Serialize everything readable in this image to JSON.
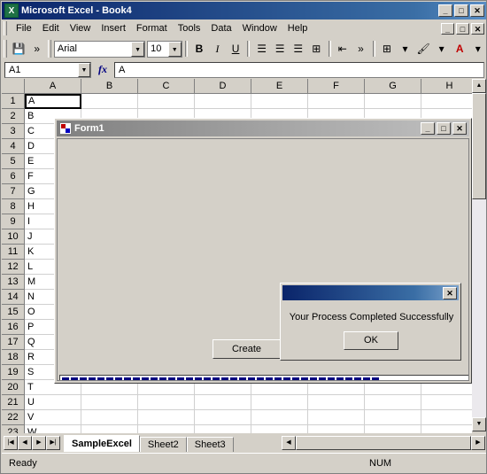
{
  "window": {
    "title": "Microsoft Excel - Book4",
    "icon": "excel-icon",
    "minimize": "_",
    "maximize": "□",
    "close": "✕"
  },
  "menu": {
    "items": [
      "File",
      "Edit",
      "View",
      "Insert",
      "Format",
      "Tools",
      "Data",
      "Window",
      "Help"
    ],
    "doc_minimize": "_",
    "doc_restore": "□",
    "doc_close": "✕"
  },
  "toolbar": {
    "buttons": [
      "save-icon",
      "more-icon"
    ],
    "font_name": "Arial",
    "font_size": "10",
    "bold": "B",
    "italic": "I",
    "underline": "U",
    "align_left": "≡",
    "align_center": "≡",
    "align_right": "≡",
    "merge": "⊞",
    "indent": "⇥",
    "borders": "⊞",
    "fill_color": "A",
    "font_color": "A",
    "dropdown_arrow": "▼"
  },
  "formula_bar": {
    "name_box": "A1",
    "fx": "fx",
    "formula_value": "A"
  },
  "sheet": {
    "columns": [
      "A",
      "B",
      "C",
      "D",
      "E",
      "F",
      "G",
      "H"
    ],
    "rows": [
      1,
      2,
      3,
      4,
      5,
      6,
      7,
      8,
      9,
      10,
      11,
      12,
      13,
      14,
      15,
      16,
      17,
      18,
      19,
      20,
      21,
      22,
      23
    ],
    "column_a_values": [
      "A",
      "B",
      "C",
      "D",
      "E",
      "F",
      "G",
      "H",
      "I",
      "J",
      "K",
      "L",
      "M",
      "N",
      "O",
      "P",
      "Q",
      "R",
      "S",
      "T",
      "U",
      "V",
      "W"
    ],
    "selected_cell": "A1"
  },
  "tabs": {
    "nav_first": "|◀",
    "nav_prev": "◀",
    "nav_next": "▶",
    "nav_last": "▶|",
    "items": [
      {
        "label": "SampleExcel",
        "active": true
      },
      {
        "label": "Sheet2",
        "active": false
      },
      {
        "label": "Sheet3",
        "active": false
      }
    ],
    "scroll_left": "◀",
    "scroll_right": "▶"
  },
  "status_bar": {
    "ready": "Ready",
    "num_lock": "NUM"
  },
  "form": {
    "title": "Form1",
    "minimize": "_",
    "maximize": "□",
    "close": "✕",
    "create_button": "Create",
    "progress_chunks": 36
  },
  "messagebox": {
    "title": "",
    "close": "✕",
    "message": "Your Process Completed Successfully",
    "ok_button": "OK"
  },
  "scrollbars": {
    "up_arrow": "▲",
    "down_arrow": "▼",
    "left_arrow": "◀",
    "right_arrow": "▶"
  }
}
